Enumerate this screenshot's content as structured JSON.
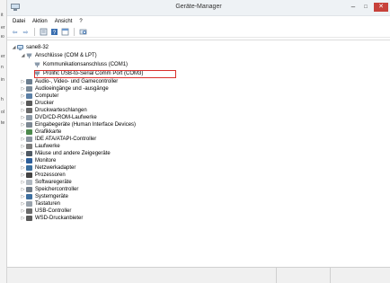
{
  "left_strip": [
    "it",
    "er",
    "ю",
    "er",
    "n",
    "in",
    "h",
    "ol",
    "te",
    "t"
  ],
  "window": {
    "title": "Geräte-Manager",
    "min_glyph": "–",
    "max_glyph": "□",
    "close_glyph": "✕"
  },
  "menu": [
    "Datei",
    "Aktion",
    "Ansicht",
    "?"
  ],
  "toolbar": {
    "back": "⇦",
    "forward": "⇨"
  },
  "tree": {
    "root": "sane8-32",
    "ports": "Anschlüsse (COM & LPT)",
    "port_children": [
      "Kommunikationsanschluss (COM1)",
      "Prolific USB-to-Serial Comm Port (COM3)"
    ],
    "categories": [
      "Audio-, Video- und Gamecontroller",
      "Audioeingänge und -ausgänge",
      "Computer",
      "Drucker",
      "Druckwarteschlangen",
      "DVD/CD-ROM-Laufwerke",
      "Eingabegeräte (Human Interface Devices)",
      "Grafikkarte",
      "IDE ATA/ATAPI-Controller",
      "Laufwerke",
      "Mäuse und andere Zeigegeräte",
      "Monitore",
      "Netzwerkadapter",
      "Prozessoren",
      "Softwaregeräte",
      "Speichercontroller",
      "Systemgeräte",
      "Tastaturen",
      "USB-Controller",
      "WSD-Druckanbieter"
    ],
    "expanded_glyph": "◢",
    "collapsed_glyph": "▷"
  },
  "colors": {
    "highlight_border": "#d9302c",
    "close_button": "#c7413a"
  }
}
